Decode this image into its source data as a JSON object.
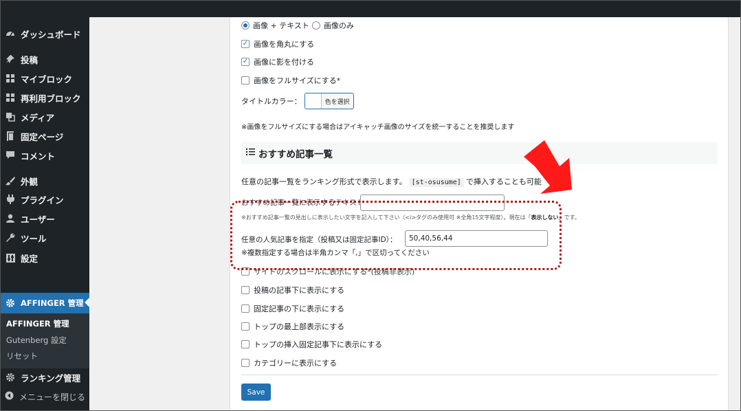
{
  "sidebar": {
    "items": [
      {
        "label": "ダッシュボード",
        "icon": "dashboard-icon"
      },
      {
        "label": "投稿",
        "icon": "pin-icon"
      },
      {
        "label": "マイブロック",
        "icon": "blocks-icon"
      },
      {
        "label": "再利用ブロック",
        "icon": "blocks-icon"
      },
      {
        "label": "メディア",
        "icon": "media-icon"
      },
      {
        "label": "固定ページ",
        "icon": "page-icon"
      },
      {
        "label": "コメント",
        "icon": "comment-icon"
      },
      {
        "label": "外観",
        "icon": "brush-icon"
      },
      {
        "label": "プラグイン",
        "icon": "plugin-icon"
      },
      {
        "label": "ユーザー",
        "icon": "user-icon"
      },
      {
        "label": "ツール",
        "icon": "wrench-icon"
      },
      {
        "label": "設定",
        "icon": "settings-icon"
      }
    ],
    "active": {
      "label": "AFFINGER 管理",
      "icon": "gear-icon"
    },
    "submenu": [
      "AFFINGER 管理",
      "Gutenberg 設定",
      "リセット"
    ],
    "ranking": {
      "label": "ランキング管理",
      "icon": "gear-icon"
    },
    "collapse_label": "メニューを閉じる"
  },
  "settings": {
    "radio_image_text": "画像 + テキスト",
    "radio_image_only": "画像のみ",
    "cb_rounded": "画像を角丸にする",
    "cb_shadow": "画像に影を付ける",
    "cb_fullsize": "画像をフルサイズにする*",
    "title_color_label": "タイトルカラー：",
    "color_button": "色を選択",
    "fullsize_note": "※画像をフルサイズにする場合はアイキャッチ画像のサイズを統一することを推奨します"
  },
  "section": {
    "title": "おすすめ記事一覧",
    "description_pre": "任意の記事一覧をランキング形式で表示します。",
    "shortcode": "[st-osusume]",
    "description_post": "で挿入することも可能",
    "heading_label": "おすすめ記事一覧に表示するテキスト",
    "heading_hint": "※おすすめ記事一覧の見出しに表示したい文字を記入して下さい（<i>タグのみ使用可 ※全角15文字程度）。現在は「",
    "heading_hint_bold": "表示しない",
    "heading_hint_end": "」です。",
    "popular_label": "任意の人気記事を指定（投稿又は固定記事ID）：",
    "popular_value": "50,40,56,44",
    "popular_note": "※複数指定する場合は半角カンマ「,」で区切ってください",
    "options": [
      "サイドのスクロールに表示にする*(投稿非表示)",
      "投稿の記事下に表示にする",
      "固定記事の下に表示にする",
      "トップの最上部表示にする",
      "トップの挿入固定記事下に表示にする",
      "カテゴリーに表示にする"
    ],
    "save_label": "Save"
  },
  "colors": {
    "accent": "#2271b1",
    "sidebar": "#1d2327",
    "highlight": "#b01818",
    "arrow": "#ff1a1a"
  }
}
